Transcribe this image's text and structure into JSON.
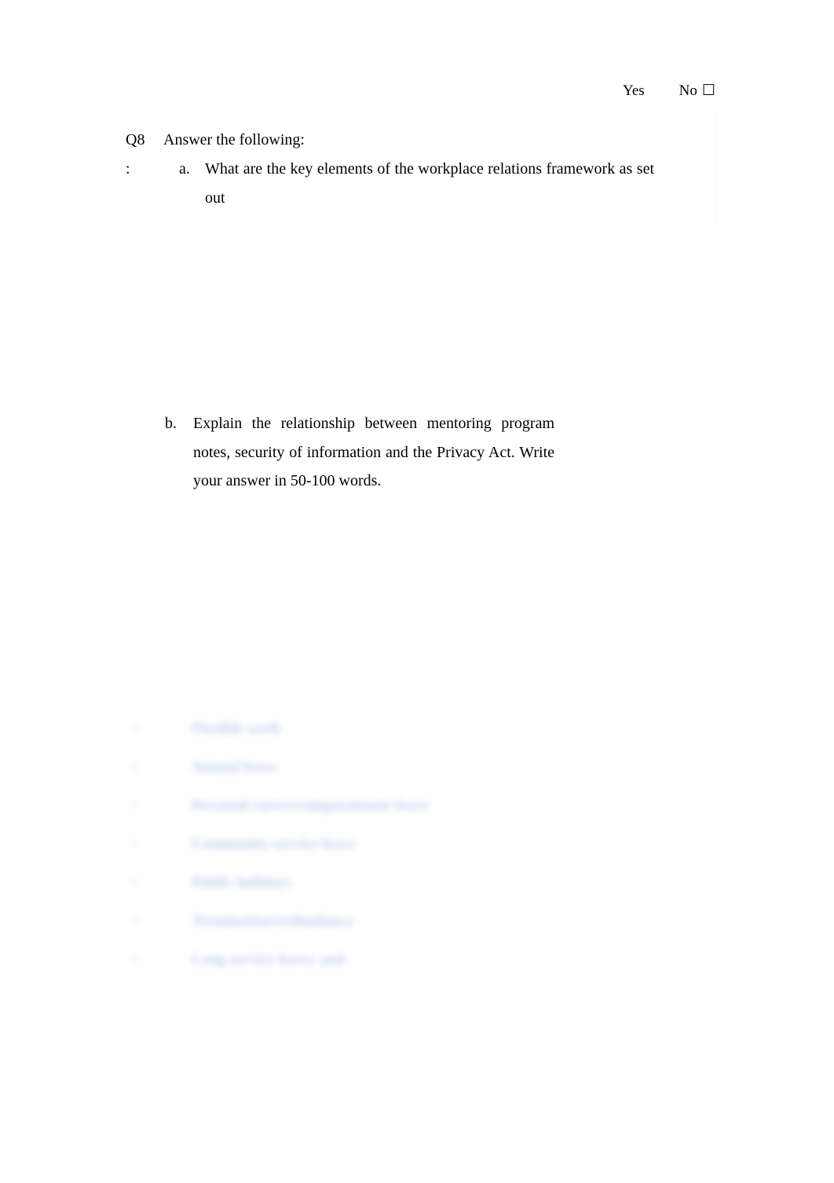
{
  "document": {
    "page_background": "#ffffff",
    "text_color": "#000000",
    "table_border_color": "#fbfbfc"
  },
  "question": {
    "number_label": "Q8",
    "colon_label": ":",
    "intro": "Answer the following:",
    "sub_questions": [
      {
        "marker": "a.",
        "text": "What are the key elements of the workplace relations framework as set out"
      },
      {
        "marker": "b.",
        "text": "Explain the relationship between mentoring program notes, security of information and the Privacy Act. Write your answer in 50-100 words."
      }
    ]
  },
  "response_options": {
    "yes_label": "Yes",
    "no_label": "No",
    "checkbox_glyph": "☐"
  },
  "redacted_block": {
    "blur_color": "#b9c5e2",
    "blur_radius_px": 4.6,
    "rows": [
      {
        "marker": "•",
        "text": "Flexible work"
      },
      {
        "marker": "•",
        "text": "Annual leave"
      },
      {
        "marker": "•",
        "text": "Personal carers/compassionate leave"
      },
      {
        "marker": "•",
        "text": "Community service leave"
      },
      {
        "marker": "•",
        "text": "Public holidays"
      },
      {
        "marker": "•",
        "text": "Termination/redundancy"
      },
      {
        "marker": "•",
        "text": "Long service leave; and"
      }
    ]
  }
}
